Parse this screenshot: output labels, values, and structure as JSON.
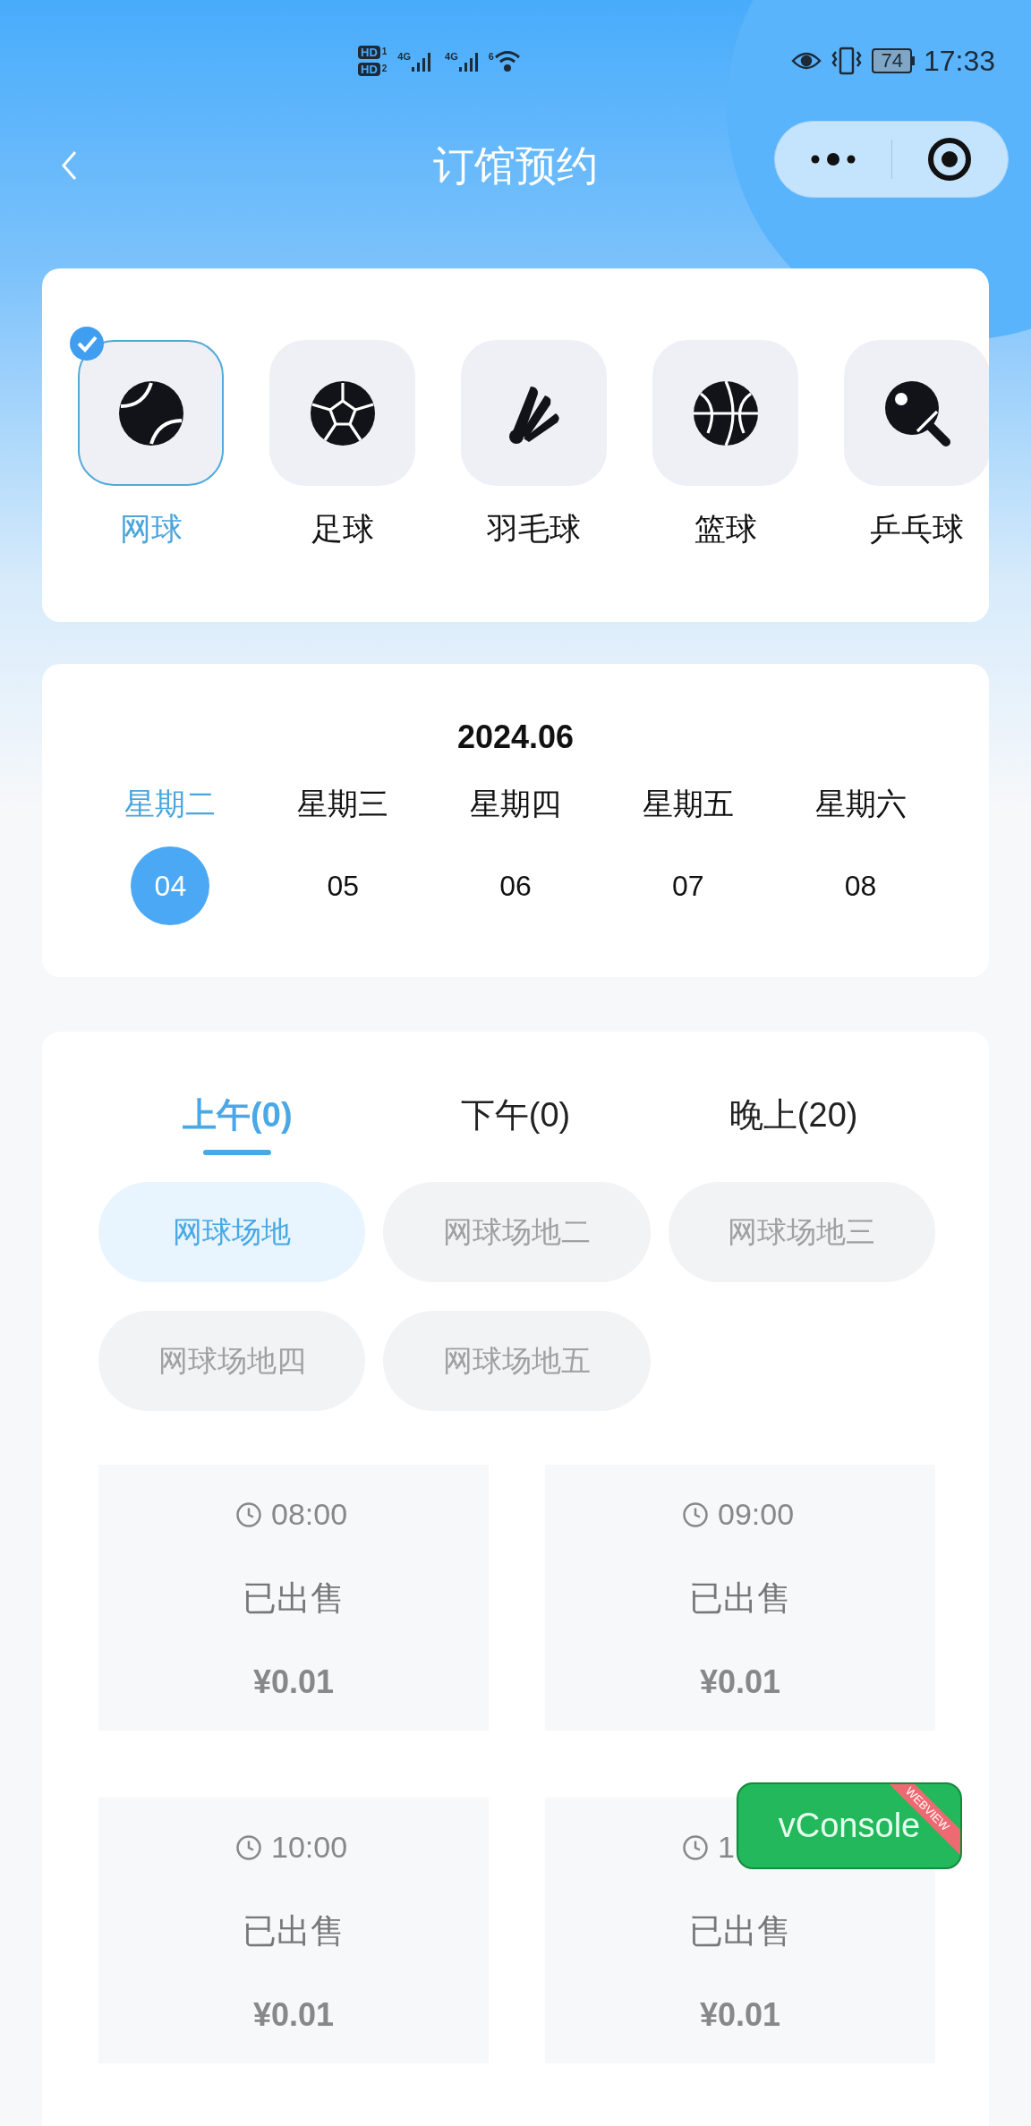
{
  "status_bar": {
    "sims": [
      {
        "badge": "HD",
        "slot": "1"
      },
      {
        "badge": "HD",
        "slot": "2"
      }
    ],
    "networks": [
      "4G",
      "4G"
    ],
    "wifi_label": "6",
    "battery": "74",
    "time": "17:33"
  },
  "nav": {
    "title": "订馆预约"
  },
  "sports": [
    {
      "kind": "tennis",
      "label": "网球",
      "selected": true
    },
    {
      "kind": "soccer",
      "label": "足球",
      "selected": false
    },
    {
      "kind": "badminton",
      "label": "羽毛球",
      "selected": false
    },
    {
      "kind": "basketball",
      "label": "篮球",
      "selected": false
    },
    {
      "kind": "pingpong",
      "label": "乒乓球",
      "selected": false
    }
  ],
  "calendar": {
    "month": "2024.06",
    "days": [
      {
        "weekday": "星期二",
        "day": "04",
        "selected": true
      },
      {
        "weekday": "星期三",
        "day": "05",
        "selected": false
      },
      {
        "weekday": "星期四",
        "day": "06",
        "selected": false
      },
      {
        "weekday": "星期五",
        "day": "07",
        "selected": false
      },
      {
        "weekday": "星期六",
        "day": "08",
        "selected": false
      }
    ]
  },
  "periods": [
    {
      "label": "上午(0)",
      "selected": true
    },
    {
      "label": "下午(0)",
      "selected": false
    },
    {
      "label": "晚上(20)",
      "selected": false
    }
  ],
  "courts": [
    {
      "label": "网球场地",
      "selected": true
    },
    {
      "label": "网球场地二",
      "selected": false
    },
    {
      "label": "网球场地三",
      "selected": false
    },
    {
      "label": "网球场地四",
      "selected": false
    },
    {
      "label": "网球场地五",
      "selected": false
    }
  ],
  "slots": [
    {
      "time": "08:00",
      "status": "已出售",
      "price": "¥0.01"
    },
    {
      "time": "09:00",
      "status": "已出售",
      "price": "¥0.01"
    },
    {
      "time": "10:00",
      "status": "已出售",
      "price": "¥0.01"
    },
    {
      "time": "1",
      "status": "已出售",
      "price": "¥0.01"
    }
  ],
  "vconsole": {
    "label": "vConsole",
    "ribbon": "WEBVIEW"
  }
}
